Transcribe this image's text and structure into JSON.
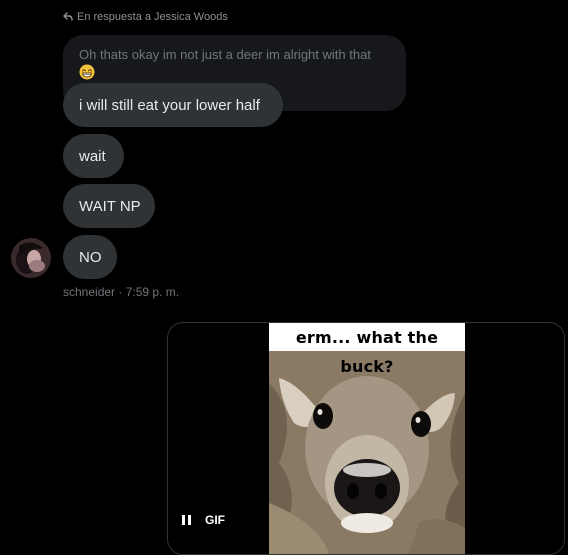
{
  "reply": {
    "label": "En respuesta a Jessica Woods"
  },
  "quoted": {
    "text": "Oh thats okay im not just a deer im alright with that",
    "emoji": "grinning-face-emoji"
  },
  "messages": [
    {
      "text": "i will still eat your lower half"
    },
    {
      "text": "wait"
    },
    {
      "text": "WAIT NP"
    },
    {
      "text": "NO"
    }
  ],
  "meta": {
    "sender": "schneider",
    "time": "7:59 p. m.",
    "line": "schneider · 7:59 p. m."
  },
  "gif": {
    "caption": "erm... what the buck?",
    "badge": "GIF",
    "state": "playing"
  },
  "colors": {
    "bubble": "#2f3336",
    "quoted_bg": "#16181c",
    "muted_text": "#71767b",
    "text": "#e7e9ea"
  }
}
